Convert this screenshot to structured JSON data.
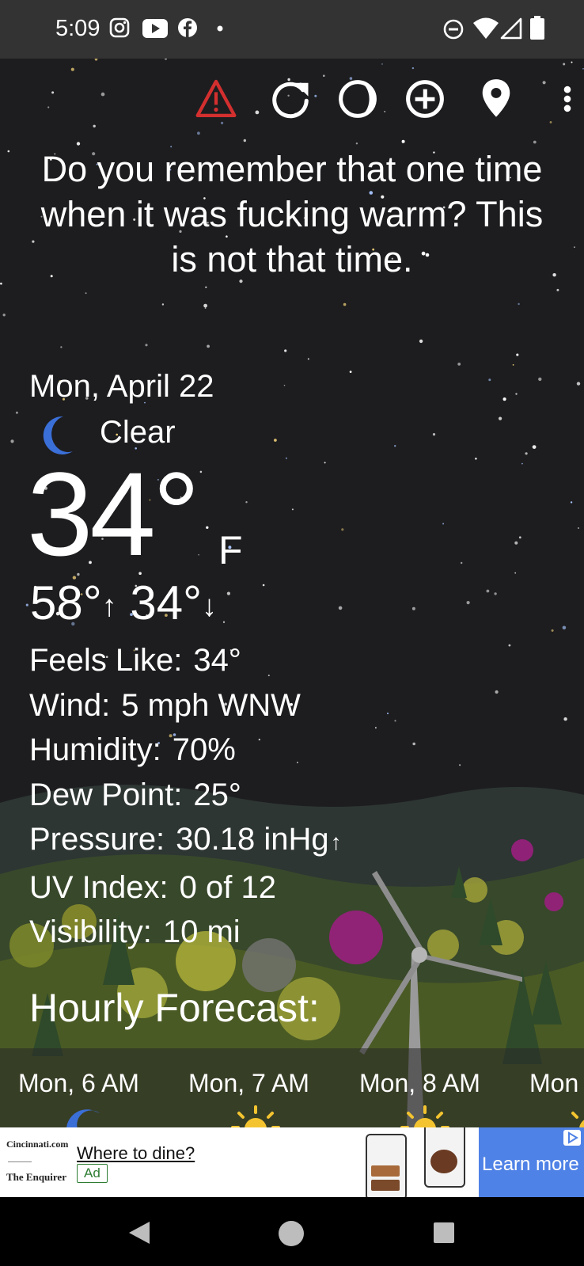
{
  "status_bar": {
    "time": "5:09",
    "left_icons": [
      "instagram-icon",
      "youtube-icon",
      "facebook-icon",
      "notification-dot-icon"
    ],
    "right_icons": [
      "do-not-disturb-icon",
      "wifi-icon",
      "cell-signal-icon",
      "battery-icon"
    ]
  },
  "toolbar": {
    "icons": [
      "alert-icon",
      "refresh-icon",
      "moon-phase-icon",
      "add-location-icon",
      "location-pin-icon",
      "more-options-icon"
    ],
    "alert_color": "#d32f2f"
  },
  "weather": {
    "message": "Do you remember that one time when it was fucking warm? This is not that time.",
    "date": "Mon, April 22",
    "condition": "Clear",
    "condition_icon": "moon-icon",
    "temperature": "34°",
    "unit": "F",
    "high": "58°",
    "low": "34°",
    "details": [
      {
        "label": "Feels Like:",
        "value": "34°"
      },
      {
        "label": "Wind:",
        "value": "5 mph WNW"
      },
      {
        "label": "Humidity:",
        "value": "70%"
      },
      {
        "label": "Dew Point:",
        "value": "25°"
      },
      {
        "label": "Pressure:",
        "value": "30.18 inHg",
        "trend_icon": "arrow-up-icon"
      },
      {
        "label": "UV Index:",
        "value": "0 of 12"
      },
      {
        "label": "Visibility:",
        "value": "10 mi"
      }
    ]
  },
  "hourly": {
    "title": "Hourly Forecast:",
    "items": [
      {
        "label": "Mon, 6 AM",
        "icon": "moon-icon"
      },
      {
        "label": "Mon, 7 AM",
        "icon": "sun-icon"
      },
      {
        "label": "Mon, 8 AM",
        "icon": "sun-icon"
      },
      {
        "label": "Mon",
        "icon": "sun-icon"
      }
    ]
  },
  "ad": {
    "brand_top": "Cincinnati.com",
    "brand_bottom": "The Enquirer",
    "headline": "Where to dine?",
    "badge": "Ad",
    "cta": "Learn more",
    "cta_color": "#4f82e6"
  },
  "nav_bar": {
    "icons": [
      "back-icon",
      "home-icon",
      "recents-icon"
    ]
  },
  "colors": {
    "moon": "#3b6fd8",
    "sun": "#f4c430",
    "sky": "#1d1d1f"
  }
}
